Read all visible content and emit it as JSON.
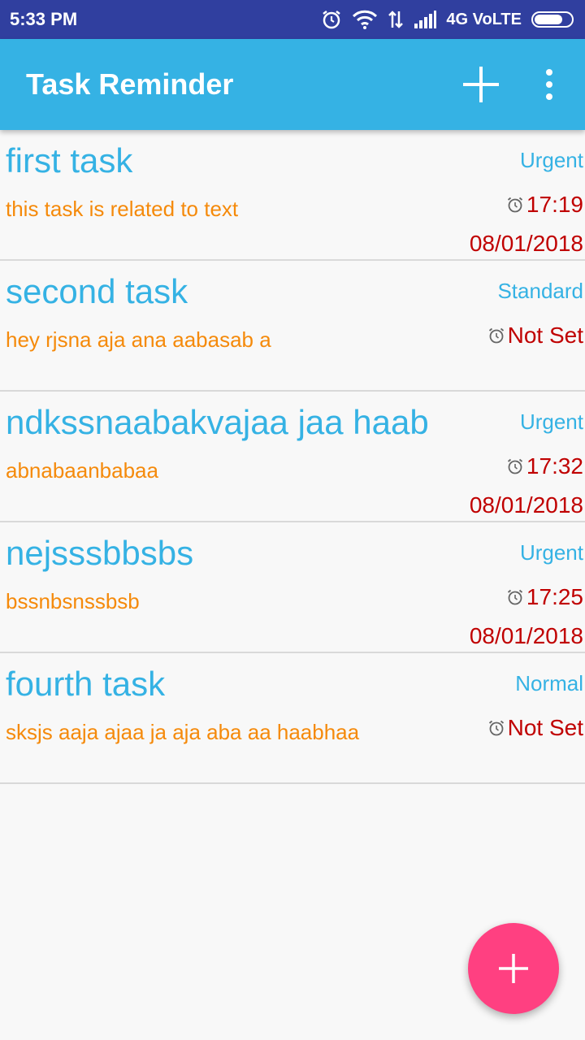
{
  "status_bar": {
    "time": "5:33 PM",
    "network": "4G VoLTE",
    "icons": [
      "alarm-icon",
      "wifi-icon",
      "data-transfer-icon",
      "signal-icon",
      "battery-icon"
    ]
  },
  "app_bar": {
    "title": "Task Reminder",
    "add_icon": "plus-icon",
    "menu_icon": "more-vert-icon"
  },
  "tasks": [
    {
      "title": "first task",
      "description": "this task is related to text",
      "priority": "Urgent",
      "time": "17:19",
      "date": "08/01/2018"
    },
    {
      "title": "second task",
      "description": "hey rjsna aja ana aabasab a",
      "priority": "Standard",
      "time": "Not Set",
      "date": ""
    },
    {
      "title": "ndkssnaabakvajaa jaa haab",
      "description": "abnabaanbabaa",
      "priority": "Urgent",
      "time": "17:32",
      "date": "08/01/2018"
    },
    {
      "title": "nejsssbbsbs",
      "description": "bssnbsnssbsb",
      "priority": "Urgent",
      "time": "17:25",
      "date": "08/01/2018"
    },
    {
      "title": "fourth task",
      "description": "sksjs aaja ajaa ja aja aba aa haabhaa",
      "priority": "Normal",
      "time": "Not Set",
      "date": ""
    }
  ],
  "colors": {
    "status_bar": "#303f9f",
    "app_bar": "#35b2e4",
    "title_text": "#35b2e4",
    "description_text": "#f58a0b",
    "time_text": "#c00000",
    "fab": "#ff4081"
  },
  "fab": {
    "icon": "plus-icon"
  }
}
